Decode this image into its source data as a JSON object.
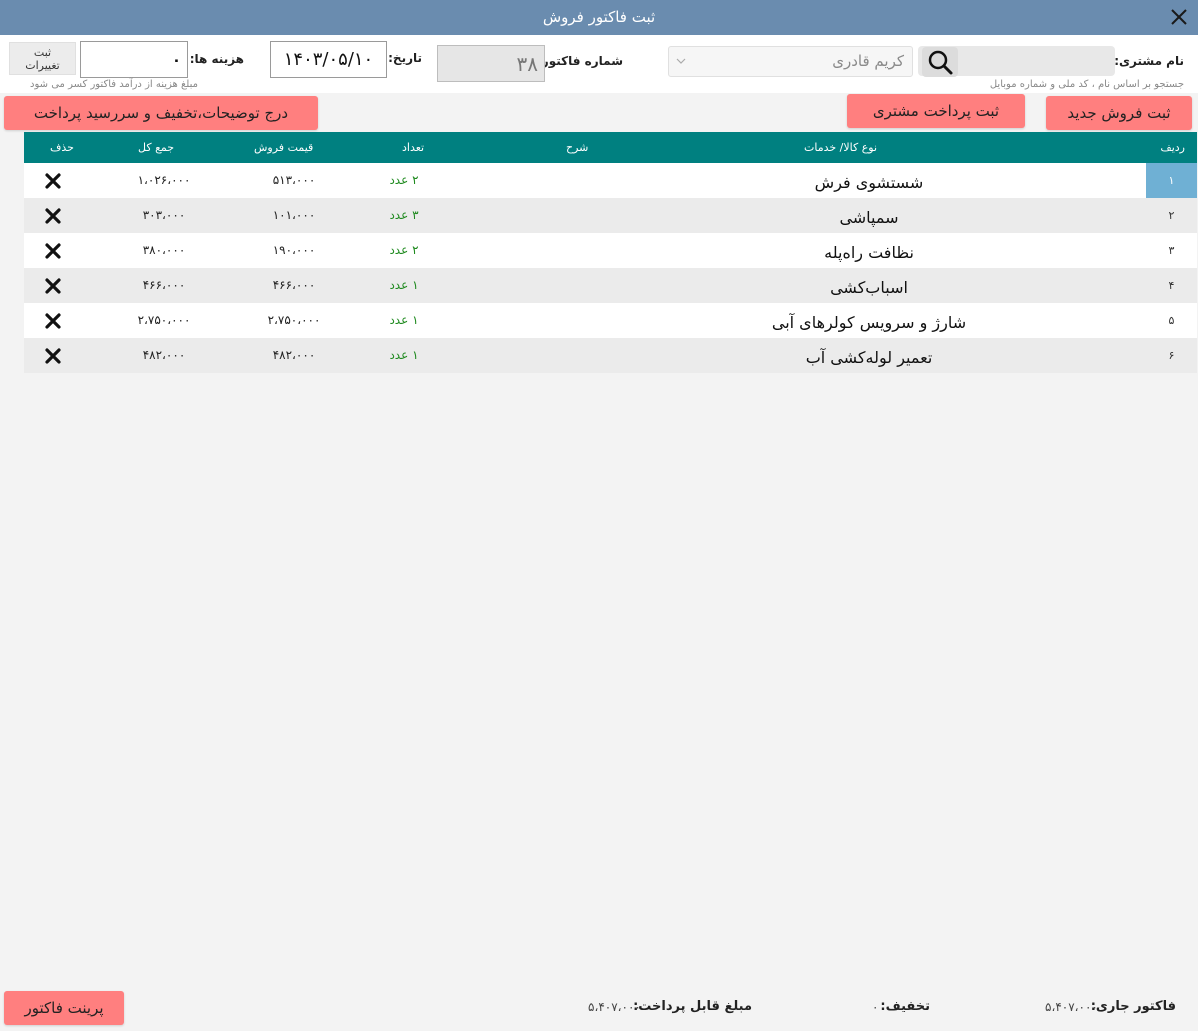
{
  "window": {
    "title": "ثبت فاکتور فروش"
  },
  "header": {
    "customer_label": "نام مشتری:",
    "customer_hint": "جستجو بر اساس نام ، کد ملی و شماره موبایل",
    "customer_value": "کریم قادری",
    "invoice_no_label": "شماره فاکتور:",
    "invoice_no_value": "۳۸",
    "date_label": "تاریخ:",
    "date_value": "۱۴۰۳/۰۵/۱۰",
    "cost_label": "هزینه ها:",
    "cost_value": "۰",
    "cost_hint": "مبلغ هزینه از درآمد فاکتور کسر می شود",
    "save_changes_label": "ثبت\nتغییرات"
  },
  "actions": {
    "new_sale": "ثبت فروش جدید",
    "customer_payment": "ثبت پرداخت مشتری",
    "notes_discount": "درج توضیحات،تخفیف و سررسید پرداخت"
  },
  "table": {
    "columns": {
      "row": "ردیف",
      "item": "نوع کالا/ خدمات",
      "desc": "شرح",
      "qty": "تعداد",
      "price": "قیمت فروش",
      "total": "جمع کل",
      "delete": "حذف"
    },
    "rows": [
      {
        "idx": "۱",
        "name": "شستشوی فرش",
        "qty": "۲ عدد",
        "price": "۵۱۳،۰۰۰",
        "total": "۱،۰۲۶،۰۰۰"
      },
      {
        "idx": "۲",
        "name": "سمپاشی",
        "qty": "۳ عدد",
        "price": "۱۰۱،۰۰۰",
        "total": "۳۰۳،۰۰۰"
      },
      {
        "idx": "۳",
        "name": "نظافت راه‌پله",
        "qty": "۲ عدد",
        "price": "۱۹۰،۰۰۰",
        "total": "۳۸۰،۰۰۰"
      },
      {
        "idx": "۴",
        "name": "اسباب‌کشی",
        "qty": "۱ عدد",
        "price": "۴۶۶،۰۰۰",
        "total": "۴۶۶،۰۰۰"
      },
      {
        "idx": "۵",
        "name": "شارژ و سرویس کولرهای آبی",
        "qty": "۱ عدد",
        "price": "۲،۷۵۰،۰۰۰",
        "total": "۲،۷۵۰،۰۰۰"
      },
      {
        "idx": "۶",
        "name": "تعمیر لوله‌کشی آب",
        "qty": "۱ عدد",
        "price": "۴۸۲،۰۰۰",
        "total": "۴۸۲،۰۰۰"
      }
    ]
  },
  "footer": {
    "current_invoice_label": "فاکتور جاری:",
    "current_invoice_value": "۵،۴۰۷،۰۰۰",
    "discount_label": "تخفیف:",
    "discount_value": "۰",
    "payable_label": "مبلغ قابل پرداخت:",
    "payable_value": "۵،۴۰۷،۰۰۰",
    "print_button": "پرینت فاکتور"
  },
  "colors": {
    "titlebar": "#6a8caf",
    "table_header": "#008080",
    "action_button": "#ff7f7f",
    "selected_row_index": "#6fb0d4",
    "qty_text": "#1f8a1f"
  }
}
